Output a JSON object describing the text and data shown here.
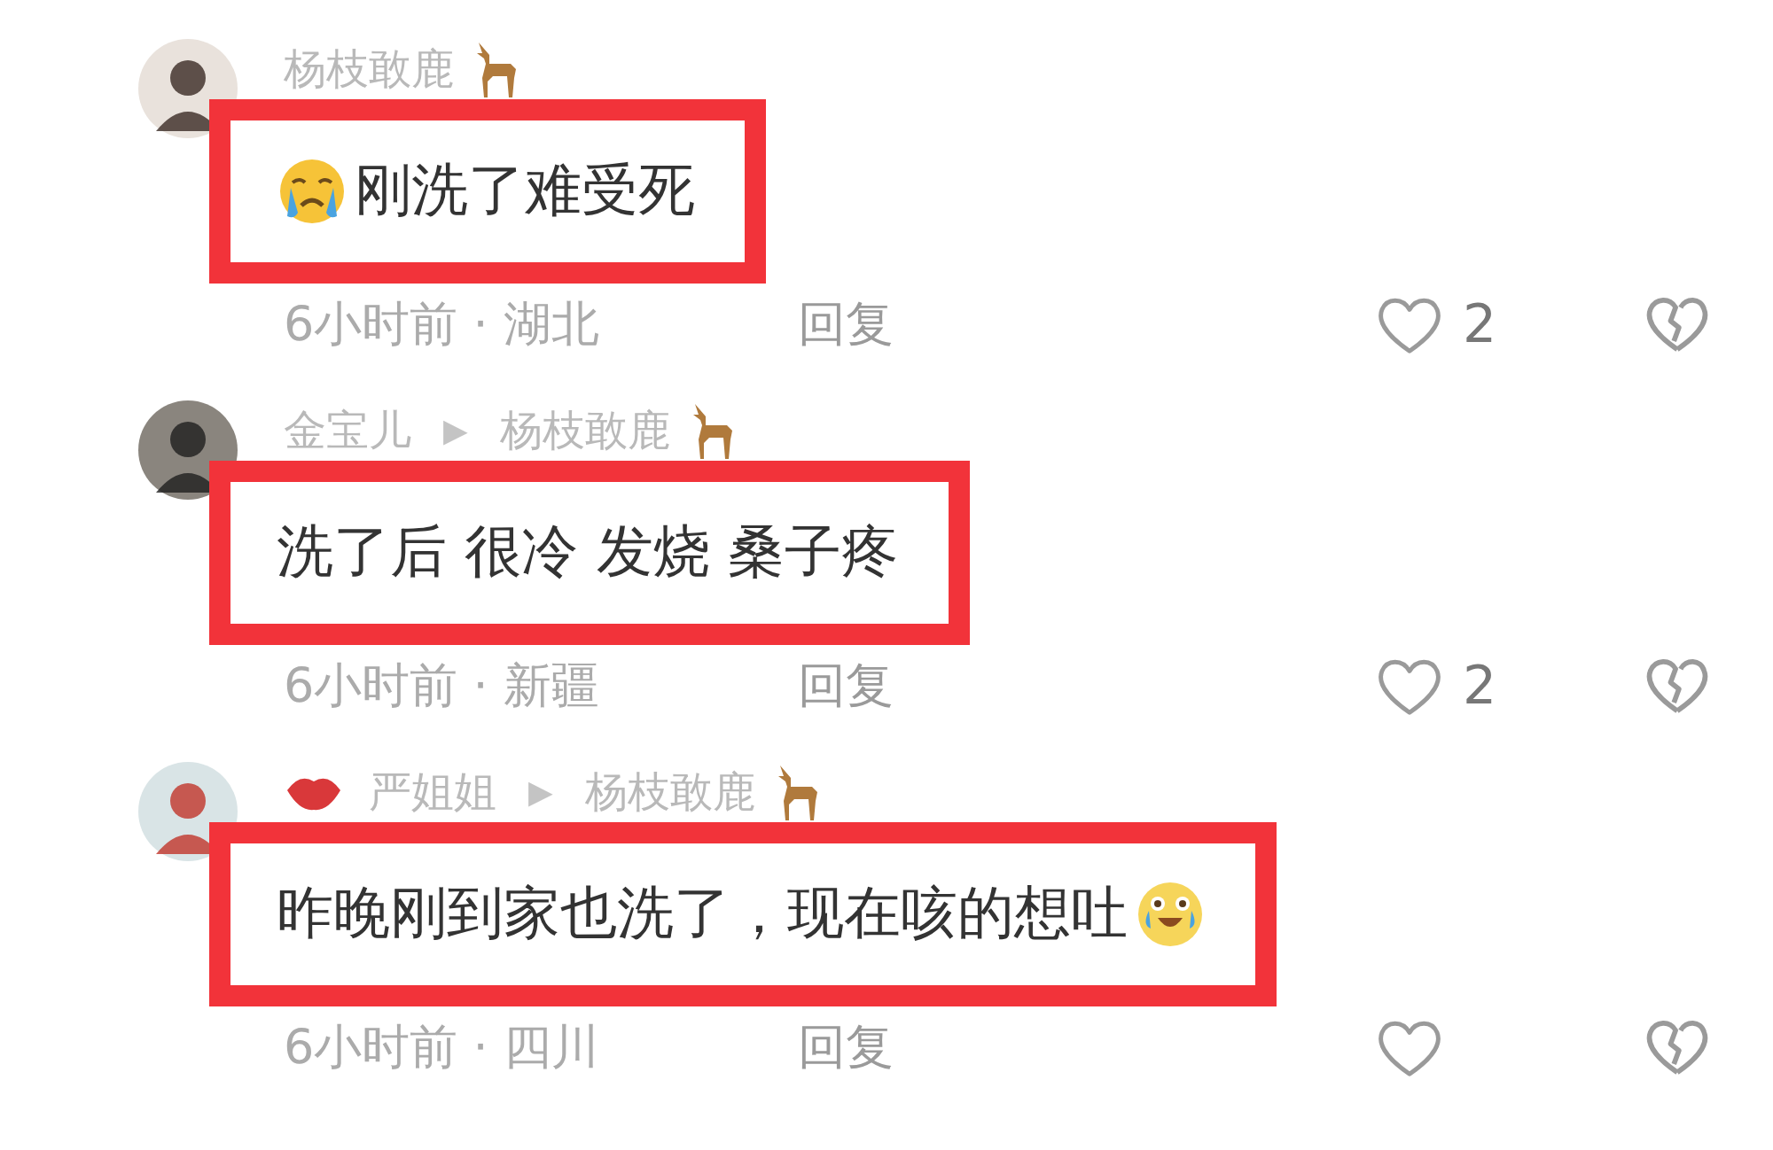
{
  "comments": [
    {
      "author": {
        "name": "杨枝敢鹿",
        "badge": {
          "kind": "deer"
        }
      },
      "leading_emoji": {
        "kind": "sad"
      },
      "text": "刚洗了难受死",
      "time": "6小时前 · 湖北",
      "reply_label": "回复",
      "likes": "2"
    },
    {
      "author": {
        "name": "金宝儿"
      },
      "arrow": "▶",
      "reply_to": {
        "name": "杨枝敢鹿",
        "badge": {
          "kind": "deer"
        }
      },
      "text": "洗了后 很冷 发烧 桑子疼",
      "time": "6小时前 · 新疆",
      "reply_label": "回复",
      "likes": "2"
    },
    {
      "author": {
        "name": "严姐姐",
        "badge": {
          "kind": "lips"
        }
      },
      "arrow": "▶",
      "reply_to": {
        "name": "杨枝敢鹿",
        "badge": {
          "kind": "deer"
        }
      },
      "text": "昨晚刚到家也洗了，现在咳的想吐",
      "trailing_emoji": {
        "kind": "joy"
      },
      "time": "6小时前 · 四川",
      "reply_label": "回复"
    }
  ]
}
